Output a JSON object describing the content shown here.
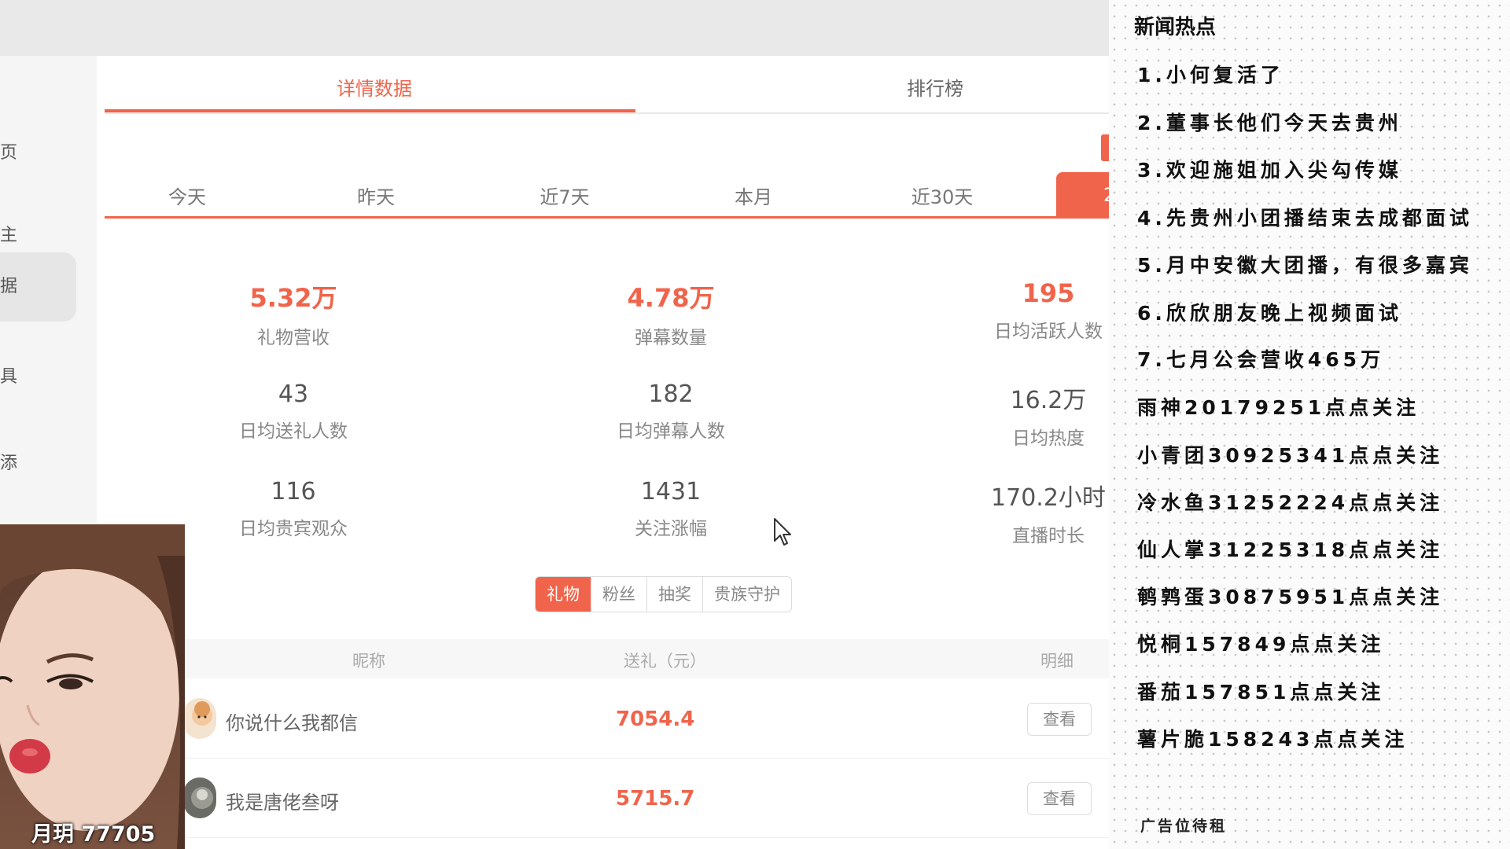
{
  "sidebar": {
    "items": [
      "页",
      "主",
      "据",
      "具",
      "添"
    ]
  },
  "tabs": [
    {
      "label": "详情数据",
      "active": true
    },
    {
      "label": "排行榜",
      "active": false
    }
  ],
  "time_ranges": [
    "今天",
    "昨天",
    "近7天",
    "本月",
    "近30天"
  ],
  "time_range_active_partial": "2",
  "stats": [
    {
      "value": "5.32万",
      "label": "礼物营收",
      "highlight": true
    },
    {
      "value": "4.78万",
      "label": "弹幕数量",
      "highlight": true
    },
    {
      "value": "195",
      "label": "日均活跃人数",
      "highlight": true
    },
    {
      "value": "43",
      "label": "日均送礼人数",
      "highlight": false
    },
    {
      "value": "182",
      "label": "日均弹幕人数",
      "highlight": false
    },
    {
      "value": "16.2万",
      "label": "日均热度",
      "highlight": false
    },
    {
      "value": "116",
      "label": "日均贵宾观众",
      "highlight": false
    },
    {
      "value": "1431",
      "label": "关注涨幅",
      "highlight": false
    },
    {
      "value": "170.2小时",
      "label": "直播时长",
      "highlight": false
    }
  ],
  "segments": [
    {
      "label": "礼物",
      "active": true
    },
    {
      "label": "粉丝",
      "active": false
    },
    {
      "label": "抽奖",
      "active": false
    },
    {
      "label": "贵族守护",
      "active": false
    }
  ],
  "table": {
    "headers": [
      "昵称",
      "送礼（元）",
      "明细"
    ],
    "rows": [
      {
        "nickname": "你说什么我都信",
        "amount": "7054.4",
        "action": "查看"
      },
      {
        "nickname": "我是唐佬叁呀",
        "amount": "5715.7",
        "action": "查看"
      }
    ]
  },
  "webcam": {
    "caption": "月玥 77705"
  },
  "news": {
    "title": "新闻热点",
    "items": [
      "1.小何复活了",
      "2.董事长他们今天去贵州",
      "3.欢迎施姐加入尖勾传媒",
      "4.先贵州小团播结束去成都面试",
      "5.月中安徽大团播，有很多嘉宾",
      "6.欣欣朋友晚上视频面试",
      "7.七月公会营收465万",
      "雨神20179251点点关注",
      "小青团30925341点点关注",
      "冷水鱼31252224点点关注",
      "仙人掌31225318点点关注",
      "鹌鹑蛋30875951点点关注",
      "悦桐157849点点关注",
      "番茄157851点点关注",
      "薯片脆158243点点关注"
    ],
    "footer": "广告位待租"
  },
  "colors": {
    "accent": "#f0644b"
  }
}
